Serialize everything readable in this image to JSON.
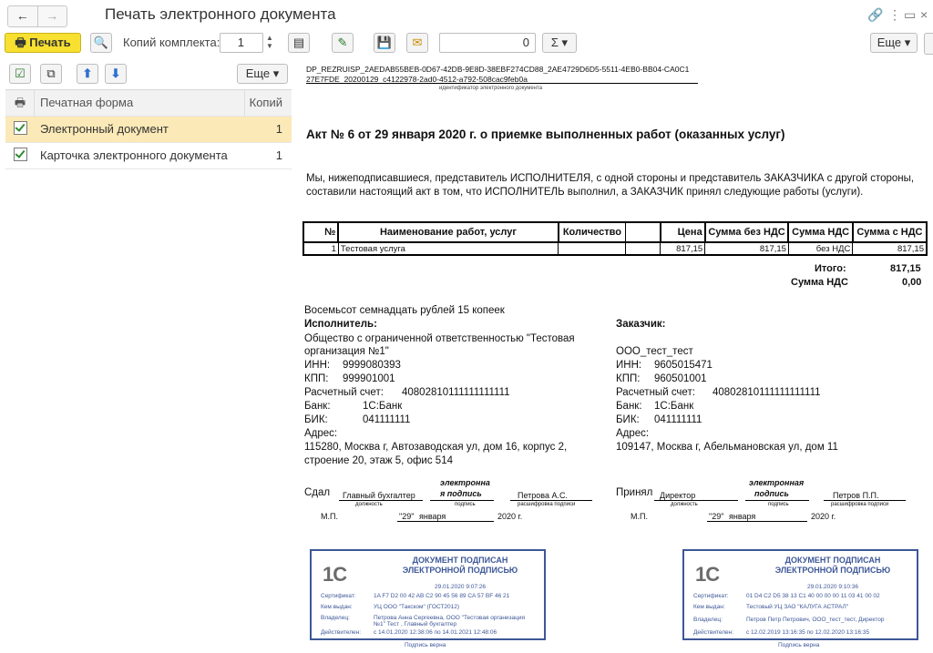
{
  "window": {
    "title": "Печать электронного документа"
  },
  "toolbar": {
    "print_label": "Печать",
    "copies_label": "Копий комплекта:",
    "copies_value": "1",
    "counter_value": "0",
    "sum_label": "Σ ▾",
    "more_label": "Еще ▾"
  },
  "leftpane": {
    "more_label": "Еще ▾",
    "head_form": "Печатная форма",
    "head_copies": "Копий",
    "rows": [
      {
        "name": "Электронный документ",
        "copies": "1"
      },
      {
        "name": "Карточка электронного документа",
        "copies": "1"
      }
    ]
  },
  "doc": {
    "id_line1": "DP_REZRUISP_2AEDAB55BEB-0D67-42DB-9E8D-38EBF274CD88_2AE4729D6D5-5511-4EB0-BB04-CA0C1",
    "id_line2": "27E7FDE_20200129_c4122978-2ad0-4512-a792-508cac9feb0a",
    "id_caption": "идентификатор электронного документа",
    "heading": "Акт № 6 от 29 января 2020 г. о приемке выполненных работ (оказанных услуг)",
    "intro1": "Мы, нижеподписавшиеся, представитель ИСПОЛНИТЕЛЯ, с одной стороны и представитель ЗАКАЗЧИКА с другой стороны,",
    "intro2": "составили настоящий акт в том, что ИСПОЛНИТЕЛЬ выполнил, а ЗАКАЗЧИК принял следующие работы (услуги).",
    "table": {
      "headers": [
        "№",
        "Наименование работ, услуг",
        "Количество",
        "",
        "Цена",
        "Сумма без НДС",
        "Сумма НДС",
        "Сумма с НДС"
      ],
      "row": [
        "1",
        "Тестовая услуга",
        "",
        "",
        "817,15",
        "817,15",
        "без НДС",
        "817,15"
      ]
    },
    "total_label": "Итого:",
    "total_value": "817,15",
    "vat_label": "Сумма НДС",
    "vat_value": "0,00",
    "words": "Восемьсот семнадцать рублей 15 копеек",
    "executor": {
      "title": "Исполнитель:",
      "name1": "Общество с ограниченной ответственностью \"Тестовая",
      "name2": "организация №1\"",
      "inn_label": "ИНН:",
      "inn": "9999080393",
      "kpp_label": "КПП:",
      "kpp": "999901001",
      "account_label": "Расчетный счет:",
      "account": "40802810111111111111",
      "bank_label": "Банк:",
      "bank": "1С:Банк",
      "bik_label": "БИК:",
      "bik": "041111111",
      "addr_label": "Адрес:",
      "addr1": "115280, Москва г, Автозаводская ул, дом 16, корпус 2,",
      "addr2": "строение 20, этаж 5, офис 514"
    },
    "customer": {
      "title": "Заказчик:",
      "name": "ООО_тест_тест",
      "inn_label": "ИНН:",
      "inn": "9605015471",
      "kpp_label": "КПП:",
      "kpp": "960501001",
      "account_label": "Расчетный счет:",
      "account": "40802810111111111111",
      "bank_label": "Банк:",
      "bank": "1С:Банк",
      "bik_label": "БИК:",
      "bik": "041111111",
      "addr_label": "Адрес:",
      "addr1": "109147, Москва г, Абельмановская ул, дом 11"
    },
    "sign_left": {
      "label": "Сдал",
      "position": "Главный бухгалтер",
      "esign1": "электронна",
      "esign2": "я подпись",
      "person": "Петрова А.С.",
      "cap_pos": "должность",
      "cap_sig": "подпись",
      "cap_name": "расшифровка подписи",
      "mp": "М.П.",
      "day": "\"29\"",
      "month": "января",
      "year": "2020 г."
    },
    "sign_right": {
      "label": "Принял",
      "position": "Директор",
      "esign1": "электронная",
      "esign2": "подпись",
      "person": "Петров П.П.",
      "cap_pos": "должность",
      "cap_sig": "подпись",
      "cap_name": "расшифровка подписи",
      "mp": "М.П.",
      "day": "\"29\"",
      "month": "января",
      "year": "2020 г."
    },
    "stamp_left": {
      "logo": "1С",
      "head1": "ДОКУМЕНТ ПОДПИСАН",
      "head2": "ЭЛЕКТРОННОЙ ПОДПИСЬЮ",
      "date": "29.01.2020 9:07:26",
      "cert_k": "Сертификат:",
      "cert_v": "1A F7 D2 00 42 AB C2 90 45 56 89 CA 57 BF 46 21",
      "issuer_k": "Кем выдан:",
      "issuer_v": "УЦ ООО \"Такском\" (ГОСТ2012)",
      "owner_k": "Владелец:",
      "owner_v1": "Петрова Анна Сергеевна, ООО \"Тестовая организация",
      "owner_v2": "№1\" Тест , Главный бухгалтер",
      "valid_k": "Действителен:",
      "valid_v": "с 14.01.2020 12:38:06 по 14.01.2021 12:48:06",
      "verified": "Подпись верна"
    },
    "stamp_right": {
      "logo": "1С",
      "head1": "ДОКУМЕНТ ПОДПИСАН",
      "head2": "ЭЛЕКТРОННОЙ ПОДПИСЬЮ",
      "date": "29.01.2020 9:10:36",
      "cert_k": "Сертификат:",
      "cert_v": "01 D4 C2 D5 38 13 C1 40 00 00 00 11 03 41 00 02",
      "issuer_k": "Кем выдан:",
      "issuer_v": "Тестовый УЦ ЗАО \"КАЛУГА АСТРАЛ\"",
      "owner_k": "Владелец:",
      "owner_v1": "Петров Петр Петрович, ООО_тест_тест, Директор",
      "valid_k": "Действителен:",
      "valid_v": "с 12.02.2019 13:16:35 по 12.02.2020 13:16:35",
      "verified": "Подпись верна"
    }
  }
}
